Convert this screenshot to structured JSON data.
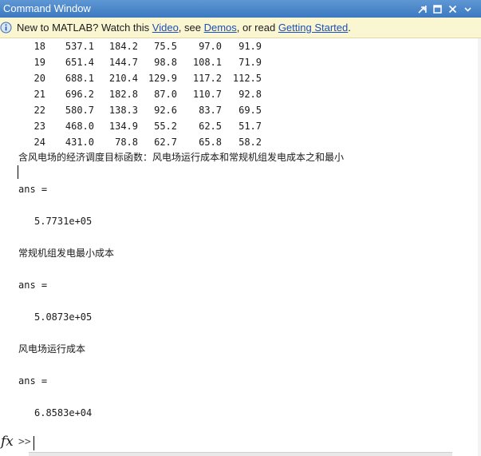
{
  "window": {
    "title": "Command Window"
  },
  "infobar": {
    "prefix": "New to MATLAB? Watch this ",
    "video_link": "Video",
    "sep1": ", see ",
    "demos_link": "Demos",
    "sep2": ", or read ",
    "getting_started_link": "Getting Started",
    "suffix": "."
  },
  "table": {
    "rows": [
      [
        "18",
        "537.1",
        "184.2",
        "75.5",
        "97.0",
        "91.9"
      ],
      [
        "19",
        "651.4",
        "144.7",
        "98.8",
        "108.1",
        "71.9"
      ],
      [
        "20",
        "688.1",
        "210.4",
        "129.9",
        "117.2",
        "112.5"
      ],
      [
        "21",
        "696.2",
        "182.8",
        "87.0",
        "110.7",
        "92.8"
      ],
      [
        "22",
        "580.7",
        "138.3",
        "92.6",
        "83.7",
        "69.5"
      ],
      [
        "23",
        "468.0",
        "134.9",
        "55.2",
        "62.5",
        "51.7"
      ],
      [
        "24",
        "431.0",
        "78.8",
        "62.7",
        "65.8",
        "58.2"
      ]
    ]
  },
  "output": {
    "heading1": "含风电场的经济调度目标函数：风电场运行成本和常规机组发电成本之和最小",
    "ans1_label": "ans =",
    "ans1_value": "5.7731e+05",
    "heading2": "常规机组发电最小成本",
    "ans2_label": "ans =",
    "ans2_value": "5.0873e+05",
    "heading3": "风电场运行成本",
    "ans3_label": "ans =",
    "ans3_value": "6.8583e+04"
  },
  "prompt": {
    "fx_symbol": "fx",
    "symbol": ">>"
  }
}
